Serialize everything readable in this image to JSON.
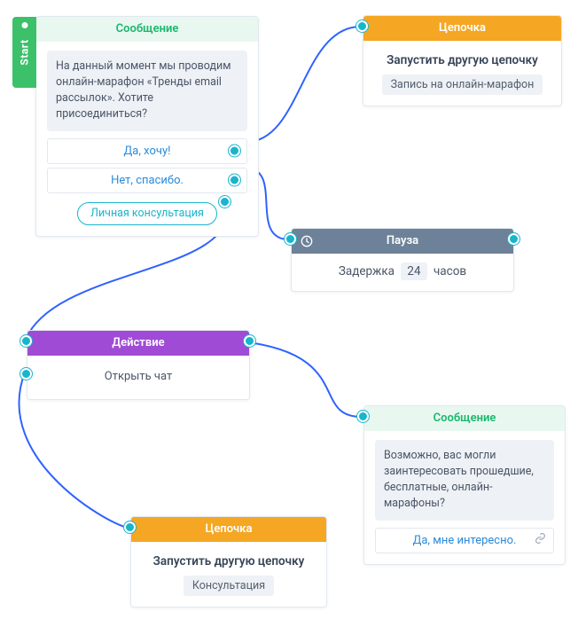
{
  "start_label": "Start",
  "nodes": {
    "n1": {
      "header": "Сообщение",
      "bubble": "На данный момент мы проводим онлайн-марафон «Тренды email рассылок». Хотите присоединиться?",
      "opt1": "Да, хочу!",
      "opt2": "Нет, спасибо.",
      "chip": "Личная консультация"
    },
    "n2": {
      "header": "Цепочка",
      "title": "Запустить другую цепочку",
      "pill": "Запись на онлайн-марафон"
    },
    "n3": {
      "header": "Пауза",
      "prefix": "Задержка",
      "value": "24",
      "suffix": "часов"
    },
    "n4": {
      "header": "Действие",
      "body": "Открыть чат"
    },
    "n5": {
      "header": "Сообщение",
      "bubble": "Возможно, вас могли заинтересовать прошедшие, бесплатные, онлайн-марафоны?",
      "opt1": "Да, мне интересно."
    },
    "n6": {
      "header": "Цепочка",
      "title": "Запустить другую цепочку",
      "pill": "Консультация"
    }
  }
}
